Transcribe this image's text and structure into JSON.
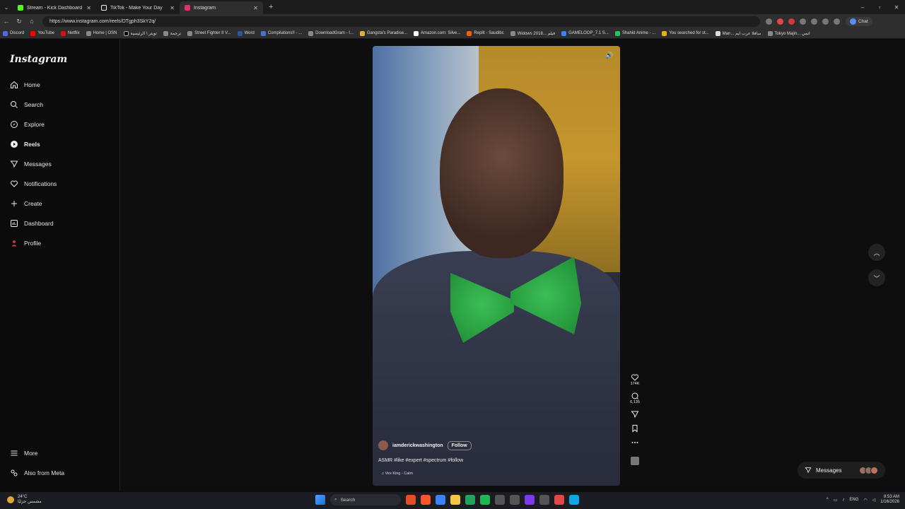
{
  "browser": {
    "tabs": [
      {
        "title": "Stream - Kick Dashboard",
        "color": "#53fc18",
        "active": false
      },
      {
        "title": "TikTok - Make Your Day",
        "color": "#ffffff",
        "active": false
      },
      {
        "title": "Instagram",
        "color": "#e1306c",
        "active": true
      }
    ],
    "url": "https://www.instagram.com/reels/DTgph3SkY2q/",
    "chat_label": "Chat",
    "bookmarks": [
      "Discord",
      "YouTube",
      "Netflix",
      "Home | OSN",
      "تويتر \\ الرئيسية",
      "ترجمة",
      "Street Fighter II V...",
      "Word",
      "Compilations!! - ...",
      "DownloadGram - I...",
      "Gangsta's Paradise...",
      "Amazon.com: Silve...",
      "Replit - Saudibc",
      "Widows 2018... فيلم",
      "GAMELOOP_7.1 S...",
      "Shahid Anime - ...",
      "You searched for st...",
      "Man... سافلا عرب ايم",
      "Tokyo Majin... انمي"
    ]
  },
  "sidebar": {
    "logo": "Instagram",
    "items": [
      {
        "label": "Home",
        "icon": "home-icon"
      },
      {
        "label": "Search",
        "icon": "search-icon"
      },
      {
        "label": "Explore",
        "icon": "explore-icon"
      },
      {
        "label": "Reels",
        "icon": "reels-icon",
        "active": true
      },
      {
        "label": "Messages",
        "icon": "messages-icon"
      },
      {
        "label": "Notifications",
        "icon": "heart-icon"
      },
      {
        "label": "Create",
        "icon": "plus-icon"
      },
      {
        "label": "Dashboard",
        "icon": "dashboard-icon"
      },
      {
        "label": "Profile",
        "icon": "profile-icon"
      }
    ],
    "more": "More",
    "also_from_meta": "Also from Meta"
  },
  "reel": {
    "author": "iamderickwashington",
    "follow_label": "Follow",
    "caption": "ASMR #like #expert #spectrum #follow",
    "audio": "Vex King - Calm",
    "likes": "174K",
    "comments": "6,135"
  },
  "messages_pill": {
    "label": "Messages"
  },
  "taskbar": {
    "temperature": "24°C",
    "weather": "مشمس جزئيًا",
    "search_placeholder": "Search",
    "lang": "ENG",
    "time": "8:53 AM",
    "date": "1/16/2026"
  }
}
